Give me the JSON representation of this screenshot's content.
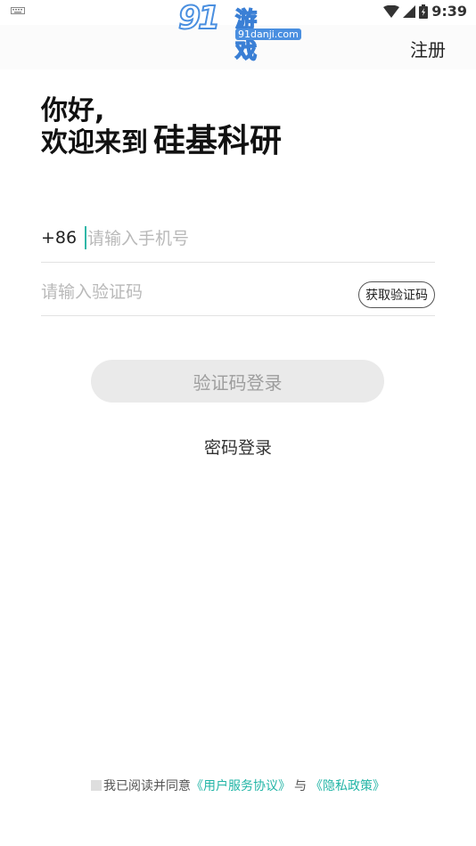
{
  "status_bar": {
    "time": "9:39",
    "icons": [
      "keyboard-icon",
      "wifi-icon",
      "cell-signal-icon",
      "battery-icon"
    ]
  },
  "watermark": {
    "number": "91",
    "text": "游戏",
    "url": "91danji.com"
  },
  "header": {
    "register_label": "注册"
  },
  "greeting": {
    "line1": "你好,",
    "line2_prefix": "欢迎来到",
    "brand": "硅基科研"
  },
  "form": {
    "country_code": "+86",
    "phone_placeholder": "请输入手机号",
    "phone_value": "",
    "code_placeholder": "请输入验证码",
    "code_value": "",
    "get_code_label": "获取验证码"
  },
  "actions": {
    "login_label": "验证码登录",
    "password_login_label": "密码登录"
  },
  "agreement": {
    "prefix": "我已阅读并同意",
    "user_agreement": "《用户服务协议》",
    "conjunction": "与",
    "privacy_policy": "《隐私政策》",
    "checked": false
  },
  "colors": {
    "accent": "#22b5a6",
    "cursor": "#2fb7a8",
    "button_disabled_bg": "#eaeaea",
    "button_disabled_text": "#9e9e9e",
    "watermark_blue": "#4a8fe0"
  }
}
